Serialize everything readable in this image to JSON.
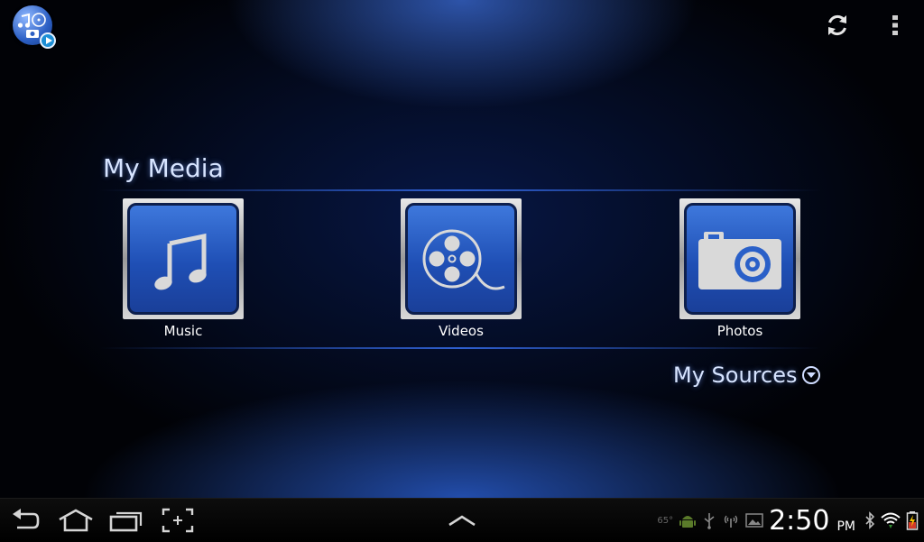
{
  "header": {
    "app_icon": "media-app-icon",
    "refresh_icon": "refresh-icon",
    "overflow_icon": "overflow-menu-icon"
  },
  "my_media": {
    "title": "My Media",
    "items": [
      {
        "label": "Music",
        "icon": "music-note-icon"
      },
      {
        "label": "Videos",
        "icon": "film-reel-icon"
      },
      {
        "label": "Photos",
        "icon": "camera-icon"
      }
    ]
  },
  "my_sources": {
    "label": "My Sources",
    "icon": "chevron-down-circle-icon"
  },
  "navbar": {
    "back_icon": "back-icon",
    "home_icon": "home-icon",
    "recent_apps_icon": "recent-apps-icon",
    "screenshot_icon": "screenshot-icon",
    "up_arrow_icon": "chevron-up-icon"
  },
  "status_bar": {
    "temperature": "65°",
    "time": "2:50",
    "ampm": "PM",
    "icons": [
      "android-icon",
      "usb-icon",
      "wireless-icon",
      "gallery-icon",
      "bluetooth-icon",
      "wifi-icon",
      "battery-icon"
    ]
  },
  "colors": {
    "accent": "#2f5fd0",
    "tile_blue": "#2a60c8",
    "title_text": "#d7e4ff"
  }
}
